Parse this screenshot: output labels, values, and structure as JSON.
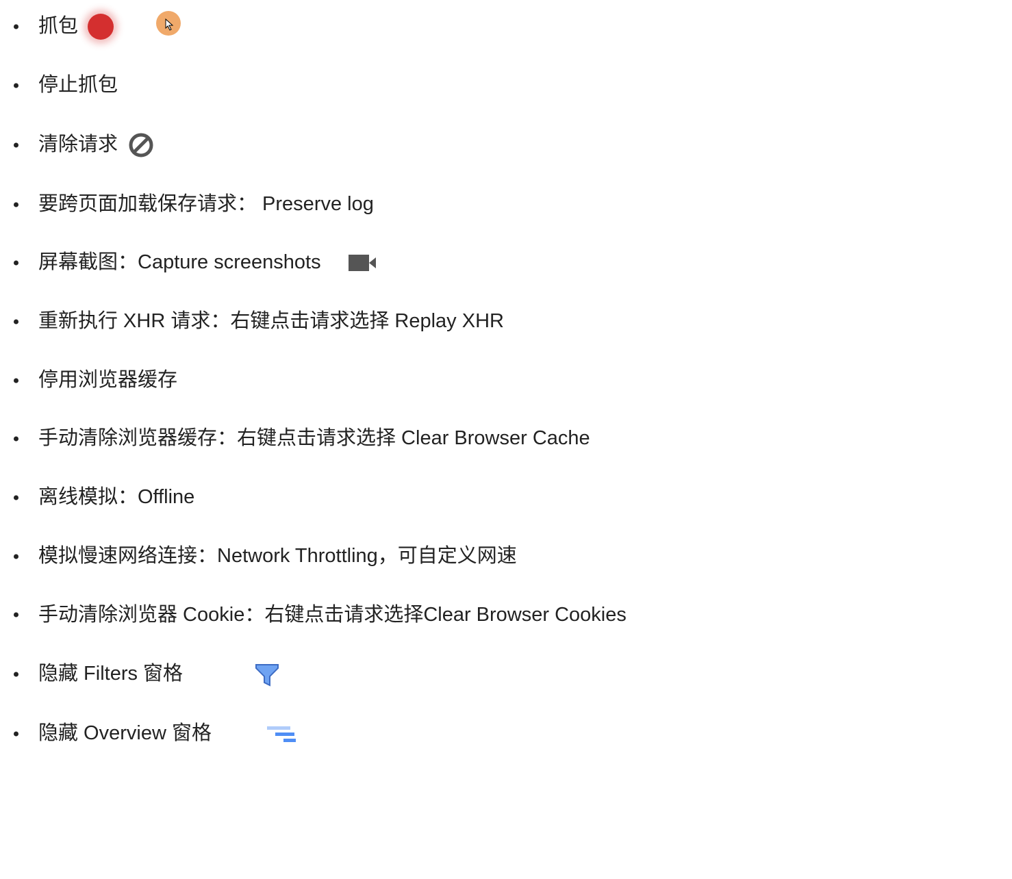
{
  "cursor_highlight": {
    "color": "#f0a96a"
  },
  "items": [
    {
      "text": "抓包",
      "icon": "record"
    },
    {
      "text": "停止抓包"
    },
    {
      "text": "清除请求",
      "icon": "prohibit"
    },
    {
      "text": "要跨页面加载保存请求： Preserve log"
    },
    {
      "text": "屏幕截图：Capture screenshots",
      "icon": "camera"
    },
    {
      "text": "重新执行 XHR 请求：右键点击请求选择 Replay XHR"
    },
    {
      "text": "停用浏览器缓存"
    },
    {
      "text": "手动清除浏览器缓存：右键点击请求选择 Clear Browser Cache"
    },
    {
      "text": "离线模拟：Offline"
    },
    {
      "text": "模拟慢速网络连接：Network Throttling，可自定义网速"
    },
    {
      "text": "手动清除浏览器 Cookie：右键点击请求选择Clear Browser Cookies"
    },
    {
      "text": "隐藏 Filters 窗格",
      "icon": "filter",
      "pad": true
    },
    {
      "text": "隐藏 Overview 窗格",
      "icon": "overview",
      "pad": true
    }
  ]
}
